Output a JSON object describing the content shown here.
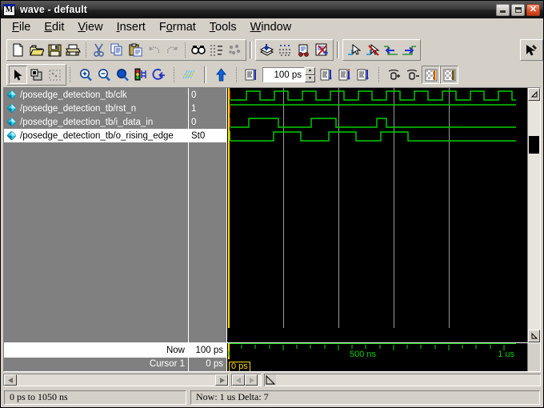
{
  "window": {
    "title": "wave - default",
    "app_icon": "modelsim-m-icon",
    "controls": {
      "minimize": "minimize-icon",
      "maximize": "maximize-icon",
      "close": "close-icon"
    }
  },
  "menubar": {
    "items": [
      {
        "label": "File",
        "accel": "F"
      },
      {
        "label": "Edit",
        "accel": "E"
      },
      {
        "label": "View",
        "accel": "V"
      },
      {
        "label": "Insert",
        "accel": "I"
      },
      {
        "label": "Format",
        "accel": "o"
      },
      {
        "label": "Tools",
        "accel": "T"
      },
      {
        "label": "Window",
        "accel": "W"
      }
    ]
  },
  "toolbar1": {
    "groups": [
      {
        "items": [
          {
            "name": "new-file-icon",
            "tooltip": "New"
          },
          {
            "name": "open-folder-icon",
            "tooltip": "Open"
          },
          {
            "name": "save-icon",
            "tooltip": "Save"
          },
          {
            "name": "print-icon",
            "tooltip": "Print"
          },
          {
            "sep": true
          },
          {
            "name": "cut-icon",
            "tooltip": "Cut"
          },
          {
            "name": "copy-icon",
            "tooltip": "Copy"
          },
          {
            "name": "paste-icon",
            "tooltip": "Paste"
          },
          {
            "name": "undo-icon",
            "tooltip": "Undo"
          },
          {
            "name": "redo-icon",
            "tooltip": "Redo"
          },
          {
            "sep": true
          },
          {
            "name": "find-icon",
            "tooltip": "Find"
          },
          {
            "name": "find-next-icon",
            "tooltip": "Find Next"
          },
          {
            "name": "find-prev-icon",
            "tooltip": "Find Previous"
          }
        ]
      },
      {
        "items": [
          {
            "name": "insert-wave-icon",
            "tooltip": "Insert"
          },
          {
            "name": "grid-icon",
            "tooltip": "Grid"
          },
          {
            "name": "run-wave-icon",
            "tooltip": "Run"
          },
          {
            "name": "delete-wave-icon",
            "tooltip": "Delete"
          }
        ]
      },
      {
        "items": [
          {
            "name": "select-mode-icon",
            "tooltip": "Select Mode"
          },
          {
            "name": "no-select-icon",
            "tooltip": "Cancel Select"
          },
          {
            "name": "prev-edge-icon",
            "tooltip": "Previous Edge"
          },
          {
            "name": "next-edge-icon",
            "tooltip": "Next Edge"
          }
        ]
      },
      {
        "items": [
          {
            "name": "edit-pointer-icon",
            "tooltip": "Edit Mode"
          }
        ]
      }
    ]
  },
  "toolbar2": {
    "mode_buttons": [
      {
        "name": "arrow-select-icon",
        "active": true
      },
      {
        "name": "zoom-region-icon",
        "active": false
      },
      {
        "name": "marquee-select-icon",
        "active": false
      }
    ],
    "zoom_buttons": [
      {
        "name": "zoom-in-icon"
      },
      {
        "name": "zoom-out-icon"
      },
      {
        "name": "zoom-full-icon"
      },
      {
        "name": "breakpoint-icon"
      },
      {
        "name": "restart-icon"
      }
    ],
    "wave_buttons": [
      {
        "name": "wave-colors-icon"
      }
    ],
    "run_button": {
      "name": "run-up-arrow-icon"
    },
    "run_group": [
      {
        "name": "run-all-icon"
      }
    ],
    "run_time": {
      "value": "100 ps",
      "spinner_up": "spin-up-icon",
      "spinner_down": "spin-down-icon"
    },
    "step_buttons": [
      {
        "name": "continue-run-icon"
      },
      {
        "name": "step-icon"
      },
      {
        "name": "step-over-icon"
      }
    ],
    "bookmark_buttons": [
      {
        "name": "add-cursor-icon"
      },
      {
        "name": "delete-cursor-icon"
      },
      {
        "name": "colorize-wave-a-icon"
      },
      {
        "name": "colorize-wave-b-icon"
      }
    ]
  },
  "signals": {
    "rows": [
      {
        "name": "/posedge_detection_tb/clk",
        "value": "0",
        "selected": false,
        "icon": "signal-diamond-icon"
      },
      {
        "name": "/posedge_detection_tb/rst_n",
        "value": "1",
        "selected": false,
        "icon": "signal-diamond-icon"
      },
      {
        "name": "/posedge_detection_tb/i_data_in",
        "value": "0",
        "selected": false,
        "icon": "signal-diamond-icon"
      },
      {
        "name": "/posedge_detection_tb/o_rising_edge",
        "value": "St0",
        "selected": true,
        "icon": "signal-diamond-icon"
      }
    ]
  },
  "footer_panel": {
    "now_label": "Now",
    "now_value": "100 ps",
    "cursor_label": "Cursor 1",
    "cursor_value": "0 ps"
  },
  "ruler": {
    "labels": [
      {
        "text": "500 ns",
        "pos": 0.5
      },
      {
        "text": "1 us",
        "pos": 1.0
      }
    ],
    "cursor_badge": "0 ps"
  },
  "statusbar": {
    "range": "0 ps to 1050 ns",
    "now_delta": "Now: 1 us   Delta: 7"
  },
  "colors": {
    "wave_green": "#00d000",
    "wave_bg": "#000000",
    "cursor_yellow": "#ffd700",
    "gridline": "#a0a0a0",
    "marker_red": "#c00000",
    "panel_gray": "#808080",
    "window_face": "#d4d0c8"
  },
  "chart_data": {
    "type": "digital-waveform",
    "title": "wave - default",
    "time_unit": "ns",
    "xlim": [
      0,
      1050
    ],
    "x_ticks_major": [
      0,
      200,
      400,
      600,
      800,
      1000
    ],
    "x_tick_labels": [
      "0 ps",
      "",
      "500 ns",
      "",
      "",
      "1 us"
    ],
    "cursor_time": "0 ps",
    "now_time": "1 us",
    "signals": [
      {
        "name": "/posedge_detection_tb/clk",
        "type": "clock",
        "current_value": "0",
        "period_ns": 50,
        "duty": 0.5,
        "first_rise_ns": 25,
        "transitions_ns": [
          25,
          50,
          75,
          100,
          125,
          150,
          175,
          200,
          225,
          250,
          275,
          300,
          325,
          350,
          375,
          400,
          425,
          450,
          475,
          500,
          525,
          550,
          575,
          600,
          625,
          650,
          675,
          700,
          725,
          750,
          775,
          800,
          825,
          850,
          875,
          900,
          925,
          950,
          975,
          1000
        ]
      },
      {
        "name": "/posedge_detection_tb/rst_n",
        "type": "level",
        "current_value": "1",
        "initial": 1,
        "transitions_ns": []
      },
      {
        "name": "/posedge_detection_tb/i_data_in",
        "type": "data",
        "current_value": "0",
        "initial": 0,
        "transitions_ns": [
          75,
          175,
          300,
          400,
          515,
          550
        ]
      },
      {
        "name": "/posedge_detection_tb/o_rising_edge",
        "type": "pulse",
        "current_value": "St0",
        "initial": 0,
        "transitions_ns": [
          150,
          225,
          325,
          400,
          500,
          575
        ]
      }
    ]
  }
}
